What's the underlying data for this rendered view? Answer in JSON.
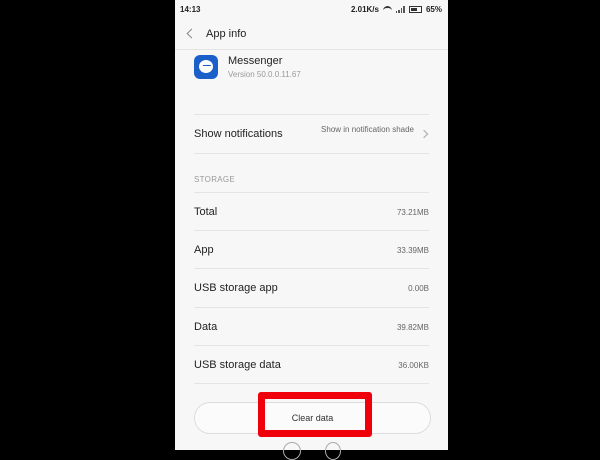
{
  "status_bar": {
    "time": "14:13",
    "network_speed": "2.01K/s",
    "battery": "65%"
  },
  "header": {
    "title": "App info"
  },
  "app": {
    "name": "Messenger",
    "version": "Version 50.0.0.11.67",
    "icon": "messenger-icon",
    "icon_color": "#1a60c8"
  },
  "notifications": {
    "label": "Show notifications",
    "value": "Show in notification shade"
  },
  "storage": {
    "section_title": "STORAGE",
    "rows": [
      {
        "label": "Total",
        "value": "73.21MB"
      },
      {
        "label": "App",
        "value": "33.39MB"
      },
      {
        "label": "USB storage app",
        "value": "0.00B"
      },
      {
        "label": "Data",
        "value": "39.82MB"
      },
      {
        "label": "USB storage data",
        "value": "36.00KB"
      }
    ]
  },
  "actions": {
    "clear_data_label": "Clear data"
  },
  "annotation": {
    "color": "#f0000a"
  }
}
